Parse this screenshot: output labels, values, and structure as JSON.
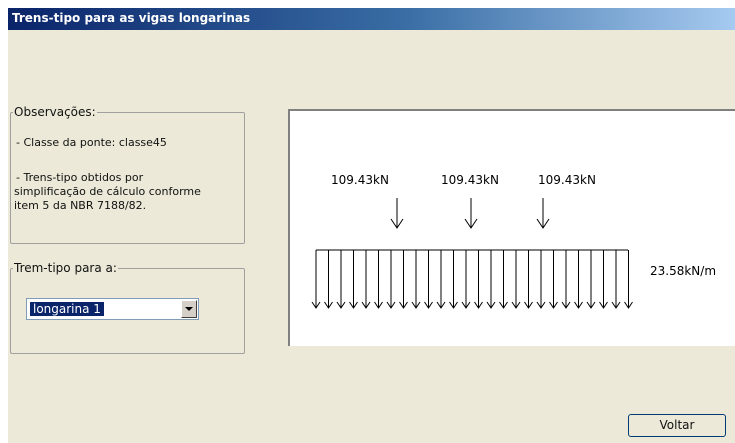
{
  "window": {
    "title": "Trens-tipo para as vigas longarinas"
  },
  "observacoes": {
    "legend": "Observações:",
    "lines": [
      " - Classe da ponte: classe45",
      " - Trens-tipo obtidos por",
      "simplificação de cálculo conforme",
      "item 5 da NBR 7188/82."
    ]
  },
  "trem_tipo": {
    "legend": "Trem-tipo para a:",
    "selected": "longarina 1"
  },
  "diagram": {
    "point_loads": [
      "109.43kN",
      "109.43kN",
      "109.43kN"
    ],
    "distributed_load": "23.58kN/m"
  },
  "buttons": {
    "voltar": "Voltar"
  },
  "colors": {
    "window_bg": "#ece9d8",
    "titlebar_start": "#0a246a",
    "titlebar_end": "#a6caf0",
    "selection": "#0a246a"
  },
  "icons": {
    "dropdown": "chevron-down-icon"
  }
}
